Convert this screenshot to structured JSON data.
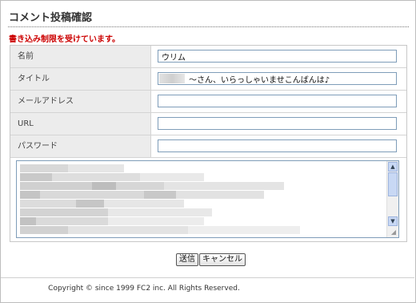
{
  "page": {
    "title": "コメント投稿確認",
    "warning": "書き込み制限を受けています。"
  },
  "form": {
    "fields": [
      {
        "label": "名前",
        "value": "ウリム"
      },
      {
        "label": "タイトル",
        "value": "～さん、いらっしゃいませこんばんは♪"
      },
      {
        "label": "メールアドレス",
        "value": ""
      },
      {
        "label": "URL",
        "value": ""
      },
      {
        "label": "パスワード",
        "value": ""
      }
    ],
    "comment_body_redacted": true
  },
  "buttons": {
    "submit": "送信",
    "cancel": "キャンセル"
  },
  "footer": {
    "copyright": "Copyright © since 1999 FC2 inc. All Rights Reserved."
  }
}
